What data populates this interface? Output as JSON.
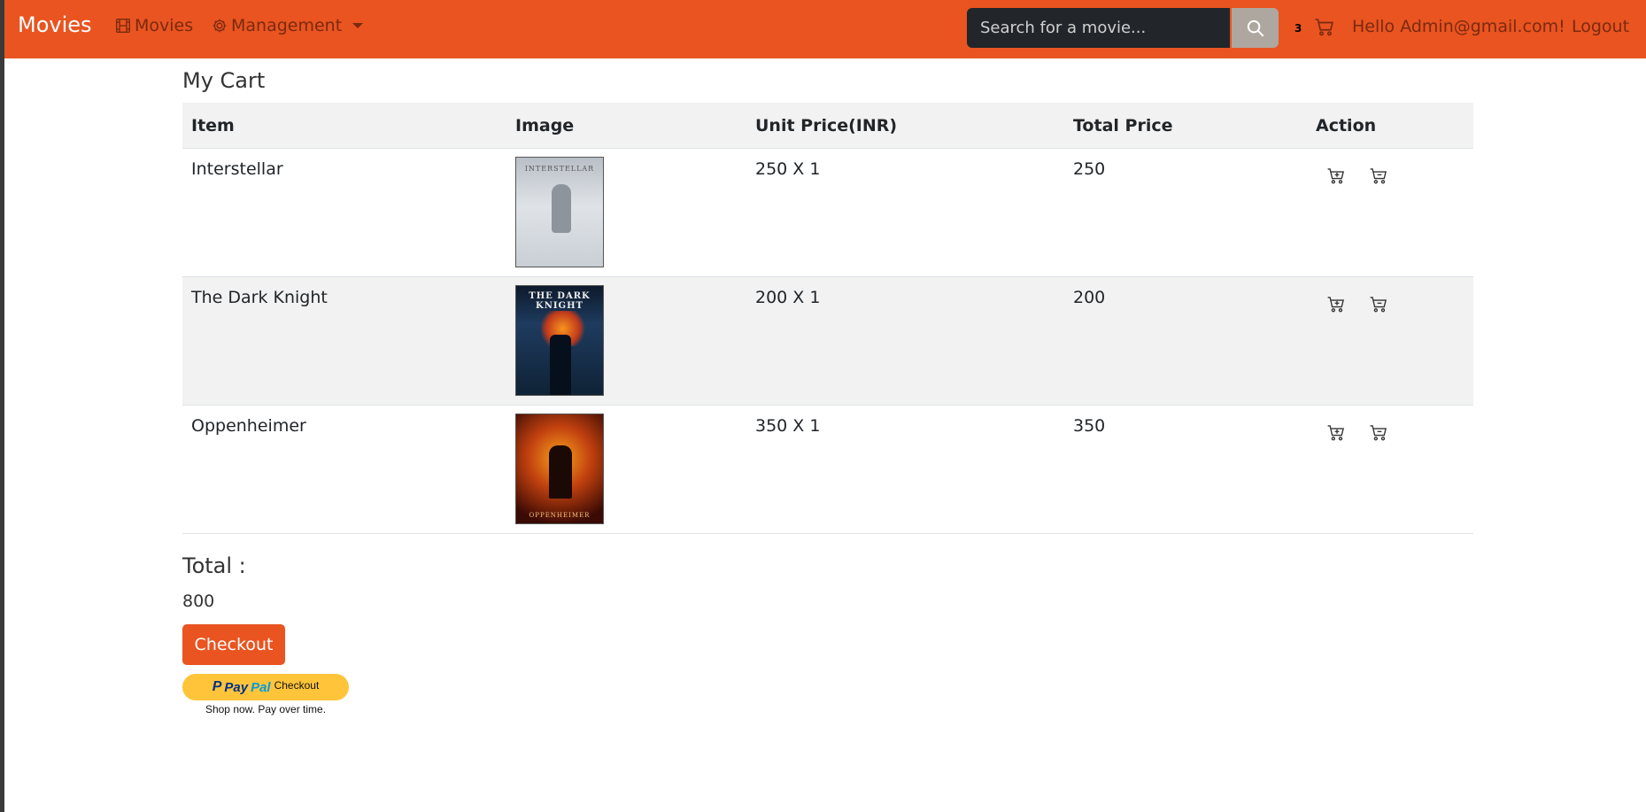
{
  "navbar": {
    "brand": "Movies",
    "movies_link": "Movies",
    "management_link": "Management",
    "search_placeholder": "Search for a movie...",
    "cart_count": "3",
    "greeting": "Hello Admin@gmail.com!",
    "logout": "Logout",
    "color": "#e95420"
  },
  "page": {
    "title": "My Cart"
  },
  "table": {
    "headers": [
      "Item",
      "Image",
      "Unit Price(INR)",
      "Total Price",
      "Action"
    ],
    "rows": [
      {
        "item": "Interstellar",
        "poster": "Interstellar poster",
        "unit_price": "250 X 1",
        "total_price": "250"
      },
      {
        "item": "The Dark Knight",
        "poster": "The Dark Knight poster",
        "poster_text": "THE DARK KNIGHT",
        "unit_price": "200 X 1",
        "total_price": "200"
      },
      {
        "item": "Oppenheimer",
        "poster": "Oppenheimer poster",
        "unit_price": "350 X 1",
        "total_price": "350"
      }
    ],
    "actions": [
      "cart-plus-icon",
      "cart-dash-icon"
    ]
  },
  "summary": {
    "total_label": "Total :",
    "total_value": "800",
    "checkout_label": "Checkout",
    "paypal_brand_pay": "Pay",
    "paypal_brand_pal": "Pal",
    "paypal_checkout": "Checkout",
    "paypal_tagline": "Shop now. Pay over time."
  }
}
